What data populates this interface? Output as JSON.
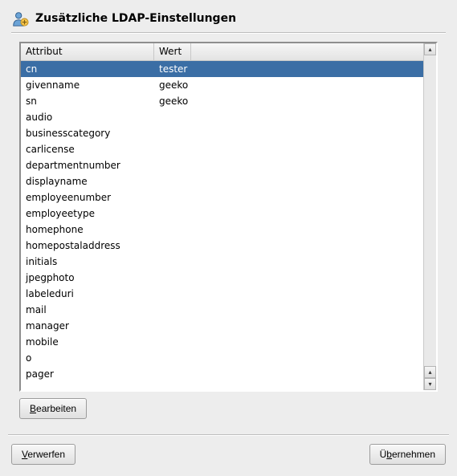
{
  "header": {
    "title": "Zusätzliche LDAP-Einstellungen",
    "icon": "ldap-user-icon"
  },
  "table": {
    "columns": {
      "attribute": "Attribut",
      "value": "Wert"
    },
    "rows": [
      {
        "attr": "cn",
        "wert": "tester",
        "selected": true
      },
      {
        "attr": "givenname",
        "wert": "geeko"
      },
      {
        "attr": "sn",
        "wert": "geeko"
      },
      {
        "attr": "audio",
        "wert": ""
      },
      {
        "attr": "businesscategory",
        "wert": ""
      },
      {
        "attr": "carlicense",
        "wert": ""
      },
      {
        "attr": "departmentnumber",
        "wert": ""
      },
      {
        "attr": "displayname",
        "wert": ""
      },
      {
        "attr": "employeenumber",
        "wert": ""
      },
      {
        "attr": "employeetype",
        "wert": ""
      },
      {
        "attr": "homephone",
        "wert": ""
      },
      {
        "attr": "homepostaladdress",
        "wert": ""
      },
      {
        "attr": "initials",
        "wert": ""
      },
      {
        "attr": "jpegphoto",
        "wert": ""
      },
      {
        "attr": "labeleduri",
        "wert": ""
      },
      {
        "attr": "mail",
        "wert": ""
      },
      {
        "attr": "manager",
        "wert": ""
      },
      {
        "attr": "mobile",
        "wert": ""
      },
      {
        "attr": "o",
        "wert": ""
      },
      {
        "attr": "pager",
        "wert": ""
      }
    ]
  },
  "buttons": {
    "edit": "Bearbeiten",
    "discard": "Verwerfen",
    "apply": "Übernehmen"
  }
}
